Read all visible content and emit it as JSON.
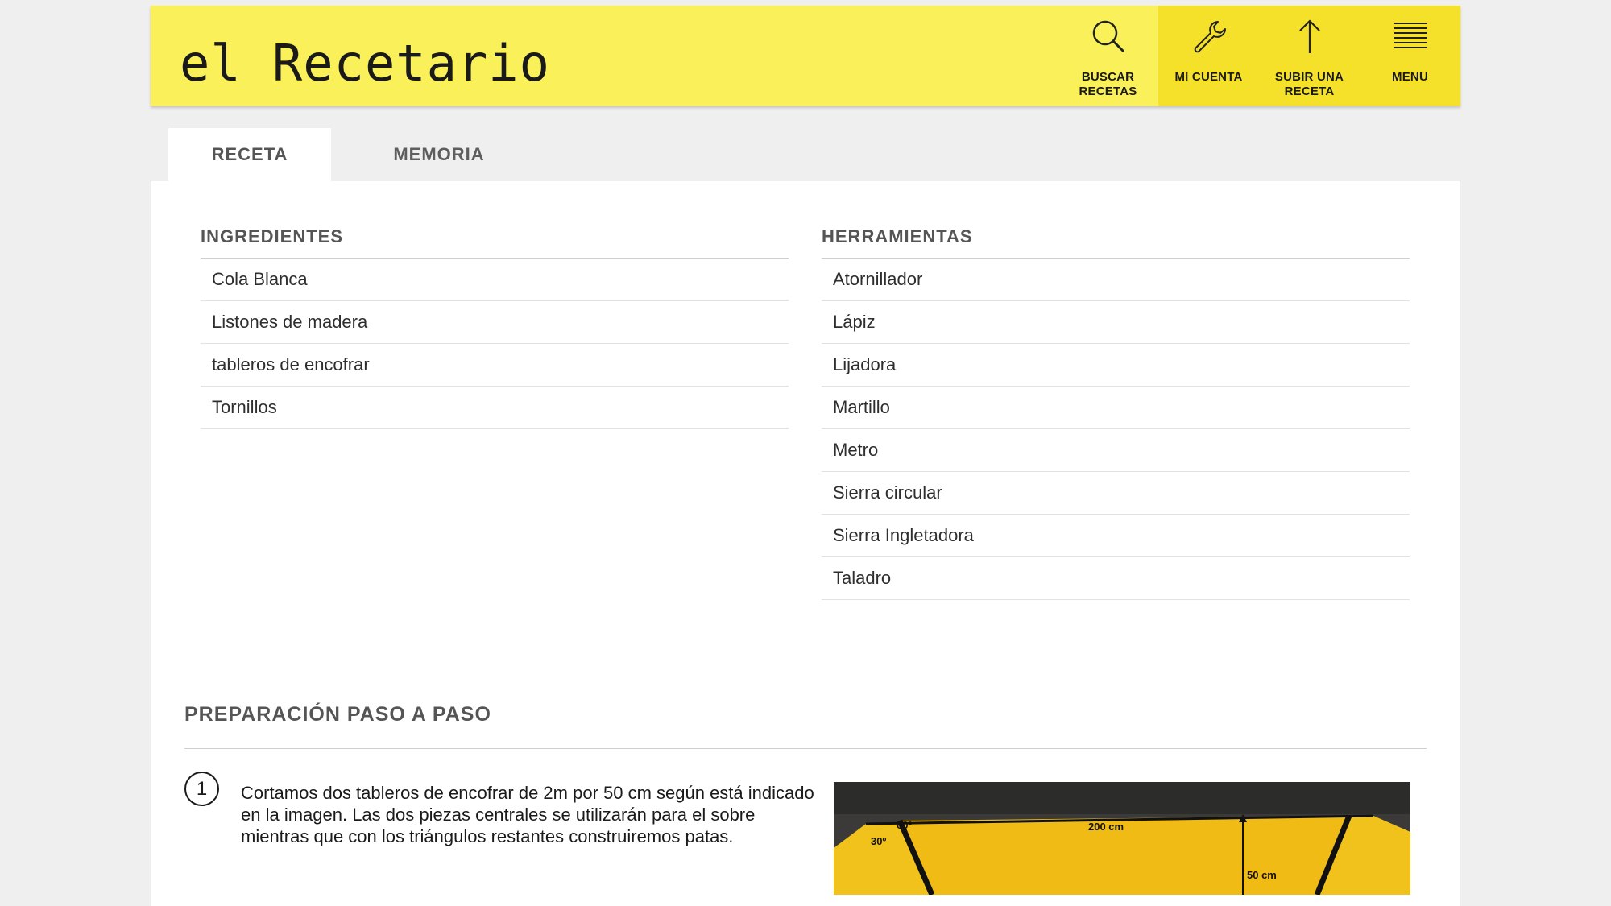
{
  "header": {
    "brand": "el Recetario",
    "nav": [
      {
        "label_line1": "BUSCAR",
        "label_line2": "RECETAS",
        "icon": "search-icon"
      },
      {
        "label_line1": "MI CUENTA",
        "label_line2": "",
        "icon": "wrench-icon"
      },
      {
        "label_line1": "SUBIR UNA",
        "label_line2": "RECETA",
        "icon": "arrow-up-icon"
      },
      {
        "label_line1": "MENU",
        "label_line2": "",
        "icon": "menu-icon"
      }
    ]
  },
  "tabs": {
    "recipe": "RECETA",
    "memory": "MEMORIA"
  },
  "ingredients": {
    "title": "INGREDIENTES",
    "items": [
      "Cola Blanca",
      "Listones de madera",
      "tableros de encofrar",
      "Tornillos"
    ]
  },
  "tools": {
    "title": "HERRAMIENTAS",
    "items": [
      "Atornillador",
      "Lápiz",
      "Lijadora",
      "Martillo",
      "Metro",
      "Sierra circular",
      "Sierra Ingletadora",
      "Taladro"
    ]
  },
  "preparation": {
    "title": "PREPARACIÓN PASO A PASO",
    "steps": [
      {
        "number": "1",
        "text": "Cortamos dos tableros de encofrar de 2m por 50 cm según está indicado en la imagen. Las dos piezas centrales se utilizarán para el sobre mientras que con los triángulos restantes construiremos patas.",
        "image_labels": {
          "angle_top": "60º",
          "angle_side": "30º",
          "length": "200 cm",
          "width": "50 cm"
        }
      }
    ]
  },
  "colors": {
    "header_bg": "#f9f05a",
    "header_active_bg": "#f5e02a",
    "page_bg": "#efefef"
  }
}
